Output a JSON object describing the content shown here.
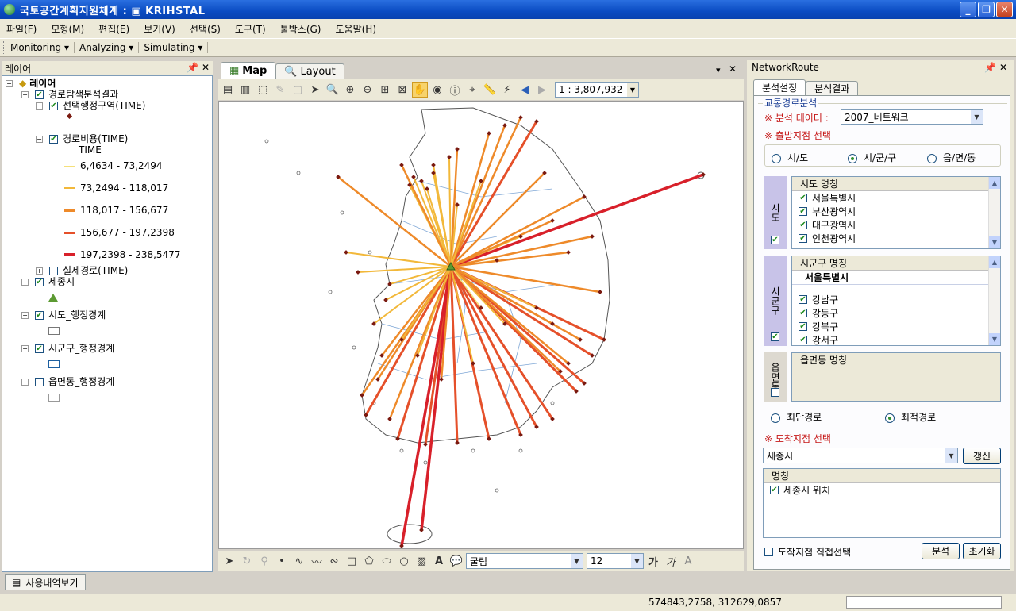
{
  "window": {
    "title": "국토공간계획지원체계 : ▣ KRIHSTAL"
  },
  "menu": [
    "파일(F)",
    "모형(M)",
    "편집(E)",
    "보기(V)",
    "선택(S)",
    "도구(T)",
    "툴박스(G)",
    "도움말(H)"
  ],
  "toolbar": [
    "Monitoring ▾",
    "Analyzing ▾",
    "Simulating ▾"
  ],
  "layers_panel": {
    "title": "레이어",
    "root": "레이어",
    "group": "경로탐색분석결과",
    "layer_selected_region": "선택행정구역(TIME)",
    "layer_cost": "경로비용(TIME)",
    "field": "TIME",
    "legend": [
      {
        "label": "6,4634 - 73,2494",
        "color": "#f5e07a"
      },
      {
        "label": "73,2494 - 118,017",
        "color": "#f2b83a"
      },
      {
        "label": "118,017 - 156,677",
        "color": "#ee8a2a"
      },
      {
        "label": "156,677 - 197,2398",
        "color": "#e5502a"
      },
      {
        "label": "197,2398 - 238,5477",
        "color": "#d8202a"
      }
    ],
    "layer_actual_route": "실제경로(TIME)",
    "layer_sejong": "세종시",
    "layer_sido": "시도_행정경계",
    "layer_sigungu": "시군구_행정경계",
    "layer_emd": "읍면동_행정경계"
  },
  "map_tabs": {
    "map": "Map",
    "layout": "Layout"
  },
  "scale": "1 : 3,807,932",
  "draw_toolbar": {
    "font": "굴림",
    "size": "12",
    "bold_glyph": "가",
    "italic_glyph": "가"
  },
  "network": {
    "title": "NetworkRoute",
    "tabs": [
      "분석설정",
      "분석결과"
    ],
    "group_title": "교통경로분석",
    "data_label": "※ 분석 데이터 :",
    "data_value": "2007_네트워크",
    "origin_label": "※ 출발지점 선택",
    "radios": [
      "시/도",
      "시/군/구",
      "읍/면/동"
    ],
    "sido_side": "시도",
    "sido_header": "시도 명칭",
    "sido_items": [
      "서울특별시",
      "부산광역시",
      "대구광역시",
      "인천광역시"
    ],
    "sigungu_side": "시군구",
    "sigungu_header": "시군구 명칭",
    "sigungu_group": "서울특별시",
    "sigungu_items": [
      "강남구",
      "강동구",
      "강북구",
      "강서구"
    ],
    "emd_side": "읍면동",
    "emd_header": "읍면동 명칭",
    "route_opts": [
      "최단경로",
      "최적경로"
    ],
    "dest_label": "※ 도착지점 선택",
    "dest_value": "세종시",
    "refresh": "갱신",
    "name_header": "명칭",
    "name_item": "세종시 위치",
    "direct_select": "도착지점 직접선택",
    "analyze": "분석",
    "reset": "초기화"
  },
  "bottom_tab": "사용내역보기",
  "status_coords": "574843,2758, 312629,0857"
}
